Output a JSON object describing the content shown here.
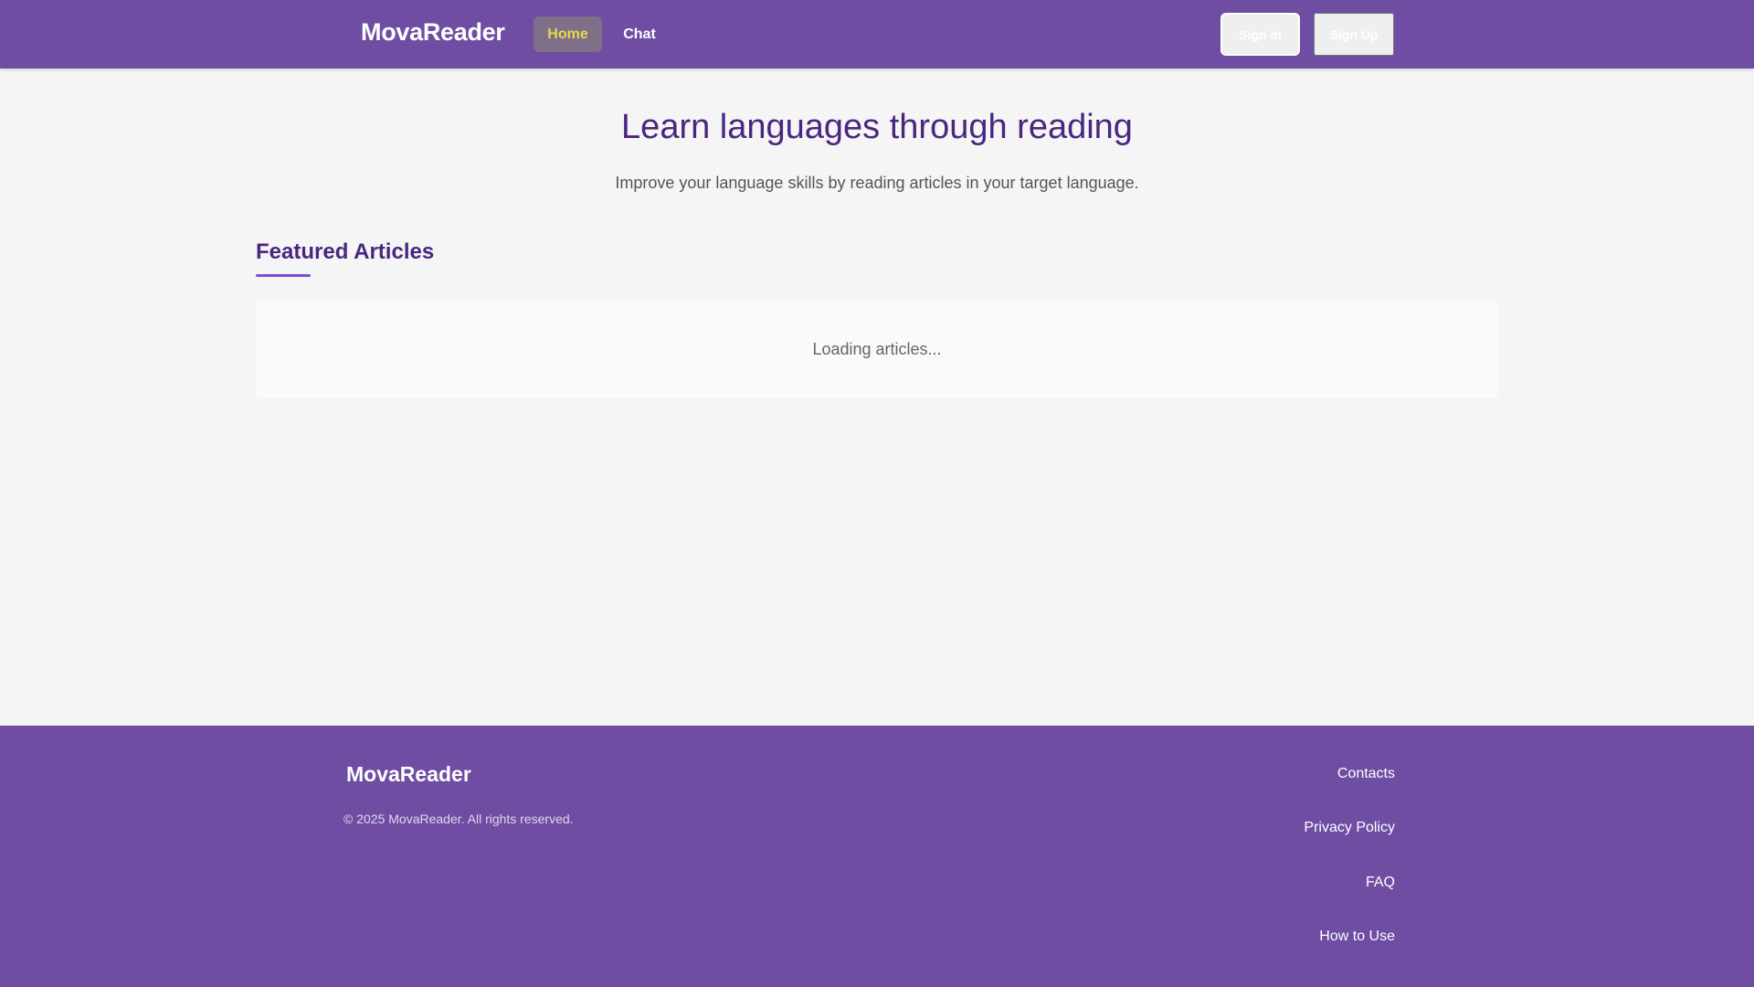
{
  "header": {
    "brand": "MovaReader",
    "nav": {
      "home": "Home",
      "chat": "Chat"
    },
    "auth": {
      "sign_in": "Sign In",
      "sign_up": "Sign Up"
    }
  },
  "hero": {
    "title": "Learn languages through reading",
    "subtitle": "Improve your language skills by reading articles in your target language."
  },
  "featured": {
    "title": "Featured Articles",
    "loading": "Loading articles..."
  },
  "footer": {
    "brand": "MovaReader",
    "copyright": "© 2025 MovaReader. All rights reserved.",
    "links": {
      "contacts": "Contacts",
      "privacy": "Privacy Policy",
      "faq": "FAQ",
      "how_to_use": "How to Use"
    }
  },
  "colors": {
    "header_bg": "#6e4da3",
    "accent_text": "#4a2680",
    "active_nav_text": "#e6d94a",
    "underline": "#7c4ddb"
  }
}
